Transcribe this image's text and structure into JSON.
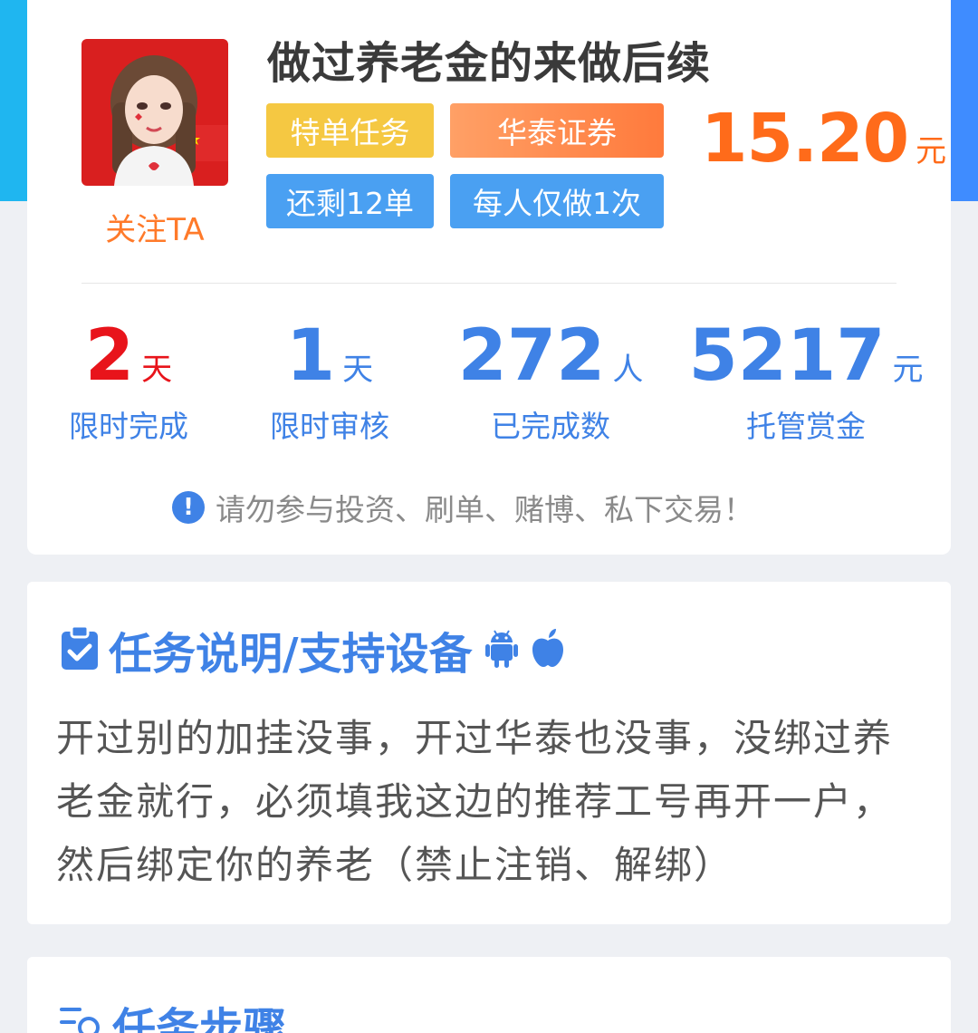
{
  "task": {
    "title": "做过养老金的来做后续",
    "follow_label": "关注TA",
    "tags": [
      "特单任务",
      "华泰证券",
      "还剩12单",
      "每人仅做1次"
    ],
    "price": "15.20",
    "price_unit": "元"
  },
  "stats": [
    {
      "value": "2",
      "unit": "天",
      "label": "限时完成"
    },
    {
      "value": "1",
      "unit": "天",
      "label": "限时审核"
    },
    {
      "value": "272",
      "unit": "人",
      "label": "已完成数"
    },
    {
      "value": "5217",
      "unit": "元",
      "label": "托管赏金"
    }
  ],
  "warning": "请勿参与投资、刷单、赌博、私下交易！",
  "description": {
    "heading": "任务说明/支持设备",
    "text": "开过别的加挂没事，开过华泰也没事，没绑过养老金就行，必须填我这边的推荐工号再开一户，然后绑定你的养老（禁止注销、解绑）"
  },
  "steps": {
    "heading": "任务步骤"
  },
  "colors": {
    "accent": "#3f82e6",
    "price": "#ff6b1a",
    "stat_red": "#e8141b"
  }
}
